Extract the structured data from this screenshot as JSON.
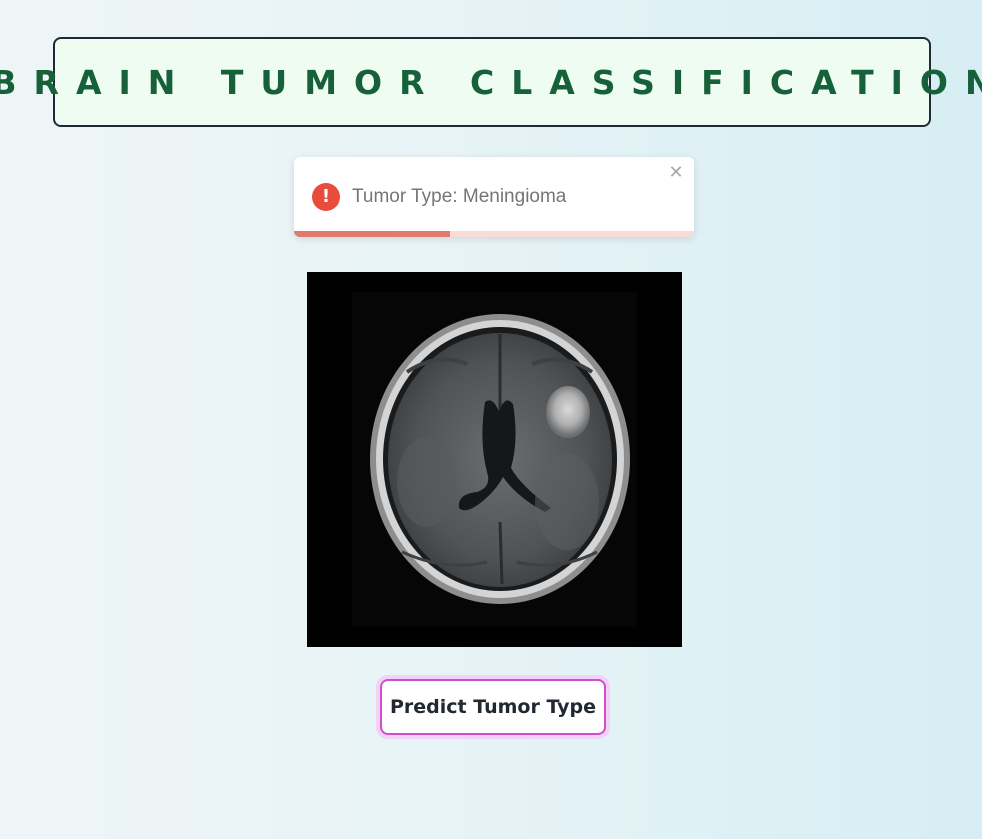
{
  "header": {
    "title": "BRAIN TUMOR CLASSIFICATION"
  },
  "toast": {
    "type": "error",
    "icon": "exclamation-circle-icon",
    "icon_glyph": "!",
    "message": "Tumor Type: Meningioma",
    "close_glyph": "✕",
    "progress_fraction": 0.39,
    "colors": {
      "icon": "#e74c3c",
      "progress_fill": "#e07a6e",
      "progress_track": "#f8dcd7"
    }
  },
  "scan_image": {
    "kind": "axial brain MRI scan"
  },
  "actions": {
    "predict_label": "Predict Tumor Type"
  },
  "colors": {
    "title_text": "#17613a",
    "title_background": "#effcf2",
    "button_border": "#cf4fc8"
  }
}
